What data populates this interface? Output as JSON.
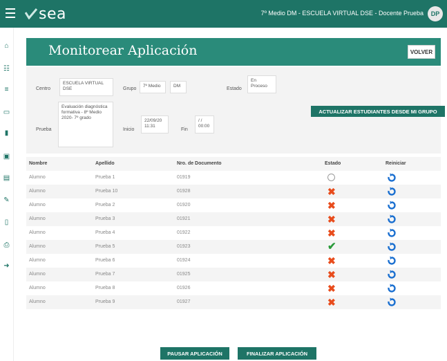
{
  "topbar": {
    "brand": "sea",
    "user": "7º Medio DM - ESCUELA VIRTUAL DSE - Docente Prueba",
    "avatar": "DP"
  },
  "sidebar_icons": [
    "home-icon",
    "users-icon",
    "list-icon",
    "folder-icon",
    "book-icon",
    "document-icon",
    "clipboard-icon",
    "pencil-icon",
    "file-icon",
    "print-icon",
    "logout-icon"
  ],
  "header": {
    "title": "Monitorear Aplicación",
    "volver": "VOLVER"
  },
  "filters": {
    "centro_label": "Centro",
    "centro_value": "ESCUELA VIRTUAL DSE",
    "grupo_label": "Grupo",
    "grupo_value": "7º Medio",
    "grupo_value2": "DM",
    "estado_label": "Estado",
    "estado_value": "En Proceso",
    "prueba_label": "Prueba",
    "prueba_value": "Evaluación diagnóstica formativa - 8º Medio 2020- 7º grado",
    "inicio_label": "Inicio",
    "inicio_value": "22/09/20 11:31",
    "fin_label": "Fin",
    "fin_value": "/ / 00:00",
    "actualizar": "ACTUALIZAR ESTUDIANTES DESDE MI GRUPO"
  },
  "table": {
    "headers": [
      "Nombre",
      "Apellido",
      "Nro. de Documento",
      "Estado",
      "Reiniciar"
    ],
    "rows": [
      {
        "nombre": "Alumno",
        "apellido": "Prueba 1",
        "doc": "01919",
        "estado": "pending"
      },
      {
        "nombre": "Alumno",
        "apellido": "Prueba 10",
        "doc": "01928",
        "estado": "x"
      },
      {
        "nombre": "Alumno",
        "apellido": "Prueba 2",
        "doc": "01920",
        "estado": "x"
      },
      {
        "nombre": "Alumno",
        "apellido": "Prueba 3",
        "doc": "01921",
        "estado": "x"
      },
      {
        "nombre": "Alumno",
        "apellido": "Prueba 4",
        "doc": "01922",
        "estado": "x"
      },
      {
        "nombre": "Alumno",
        "apellido": "Prueba 5",
        "doc": "01923",
        "estado": "ok"
      },
      {
        "nombre": "Alumno",
        "apellido": "Prueba 6",
        "doc": "01924",
        "estado": "x"
      },
      {
        "nombre": "Alumno",
        "apellido": "Prueba 7",
        "doc": "01925",
        "estado": "x"
      },
      {
        "nombre": "Alumno",
        "apellido": "Prueba 8",
        "doc": "01926",
        "estado": "x"
      },
      {
        "nombre": "Alumno",
        "apellido": "Prueba 9",
        "doc": "01927",
        "estado": "x"
      }
    ]
  },
  "footer": {
    "pausar": "PAUSAR APLICACIÓN",
    "finalizar": "FINALIZAR APLICACIÓN"
  },
  "colors": {
    "primary": "#1e7466",
    "header": "#2a8b7a",
    "error": "#e84c1c",
    "success": "#2a9a3a",
    "reset": "#1a6fd0"
  }
}
